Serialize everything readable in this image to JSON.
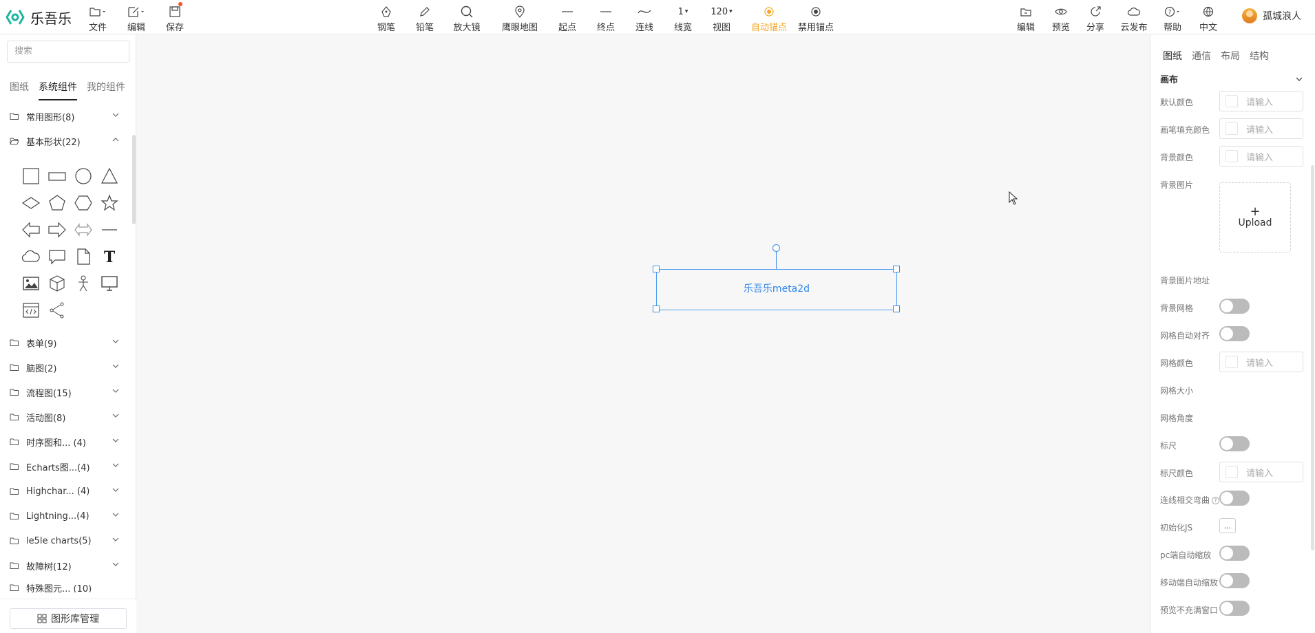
{
  "header": {
    "app_name": "乐吾乐",
    "left_tools": [
      {
        "label": "文件",
        "icon": "file-icon"
      },
      {
        "label": "编辑",
        "icon": "edit-icon"
      },
      {
        "label": "保存",
        "icon": "save-icon"
      }
    ],
    "center_tools": [
      {
        "label": "钢笔",
        "icon": "pen-icon"
      },
      {
        "label": "铅笔",
        "icon": "pencil-icon"
      },
      {
        "label": "放大镜",
        "icon": "magnifier-icon"
      },
      {
        "label": "鹰眼地图",
        "icon": "location-icon"
      },
      {
        "label": "起点",
        "icon": "line-start-icon"
      },
      {
        "label": "终点",
        "icon": "line-end-icon"
      },
      {
        "label": "连线",
        "icon": "curve-line-icon"
      },
      {
        "label": "线宽",
        "value": "1"
      },
      {
        "label": "视图",
        "value": "120"
      },
      {
        "label": "自动锚点",
        "icon": "anchor-icon"
      },
      {
        "label": "禁用锚点",
        "icon": "anchor-disabled-icon"
      }
    ],
    "right_tools": [
      {
        "label": "编辑",
        "icon": "folder-edit-icon"
      },
      {
        "label": "预览",
        "icon": "eye-icon"
      },
      {
        "label": "分享",
        "icon": "share-icon"
      },
      {
        "label": "云发布",
        "icon": "cloud-icon"
      },
      {
        "label": "帮助",
        "icon": "help-icon"
      },
      {
        "label": "中文",
        "icon": "globe-icon"
      }
    ],
    "user_name": "孤城浪人"
  },
  "left": {
    "search_placeholder": "搜索",
    "tabs": [
      "图纸",
      "系统组件",
      "我的组件"
    ],
    "categories_top": [
      {
        "label": "常用图形(8)",
        "expanded": false
      },
      {
        "label": "基本形状(22)",
        "expanded": true
      }
    ],
    "shape_icons": [
      "square-shape-icon",
      "rectangle-shape-icon",
      "circle-shape-icon",
      "triangle-shape-icon",
      "diamond-shape-icon",
      "pentagon-shape-icon",
      "hexagon-shape-icon",
      "star-shape-icon",
      "left-arrow-shape-icon",
      "right-arrow-shape-icon",
      "double-arrow-shape-icon",
      "line-shape-icon",
      "cloud-shape-icon",
      "message-shape-icon",
      "file-shape-icon",
      "text-shape-icon",
      "image-shape-icon",
      "cube-shape-icon",
      "person-shape-icon",
      "monitor-shape-icon",
      "code-shape-icon",
      "share-shape-icon"
    ],
    "categories_bottom": [
      "表单(9)",
      "脑图(2)",
      "流程图(15)",
      "活动图(8)",
      "时序图和... (4)",
      "Echarts图...(4)",
      "Highchar... (4)",
      "Lightning...(4)",
      "le5le charts(5)",
      "故障树(12)",
      "特殊图元... (10)"
    ],
    "library_button": "图形库管理"
  },
  "canvas": {
    "node_text": "乐吾乐meta2d"
  },
  "right": {
    "tabs": [
      "图纸",
      "通信",
      "布局",
      "结构"
    ],
    "section_title": "画布",
    "input_placeholder": "请输入",
    "upload_label": "Upload",
    "labels": {
      "default_color": "默认颜色",
      "brush_fill": "画笔填充颜色",
      "bg_color": "背景颜色",
      "bg_image": "背景图片",
      "bg_image_url": "背景图片地址",
      "bg_grid": "背景网格",
      "grid_snap": "网格自动对齐",
      "grid_color": "网格颜色",
      "grid_size": "网格大小",
      "grid_angle": "网格角度",
      "ruler": "标尺",
      "ruler_color": "标尺颜色",
      "line_cross": "连线相交弯曲",
      "init_js": "初始化JS",
      "pc_autoscale": "pc端自动缩放",
      "mobile_autoscale": "移动端自动缩放",
      "preview_fill": "预览不充满窗口"
    },
    "init_js_button": "...",
    "help_mark": "?"
  },
  "colors": {
    "accent": "#f5a623",
    "selection": "#3a8ee6",
    "toggle_off": "#bbbbbb"
  }
}
